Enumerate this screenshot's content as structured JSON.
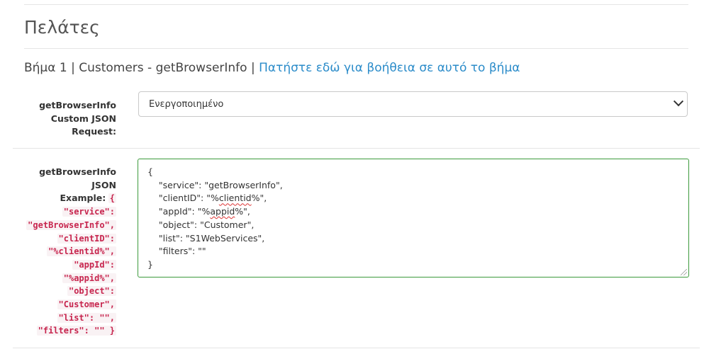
{
  "page": {
    "section_title": "Πελάτες",
    "step_prefix": "Βήμα 1 | Customers - getBrowserInfo |",
    "help_link": "Πατήστε εδώ για βοήθεια σε αυτό το βήμα"
  },
  "field_custom_request": {
    "label_lines": [
      "getBrowserInfo",
      "Custom JSON",
      "Request:"
    ],
    "selected_value": "Ενεργοποιημένο"
  },
  "field_json": {
    "label_lines": [
      "getBrowserInfo",
      "JSON"
    ],
    "example_word": "Example:",
    "example_code_lines": [
      "{",
      "\"service\":",
      "\"getBrowserInfo\",",
      "\"clientID\":",
      "\"%clientid%\",",
      "\"appId\":",
      "\"%appid%\",",
      "\"object\":",
      "\"Customer\",",
      "\"list\": \"\",",
      "\"filters\": \"\" }"
    ],
    "textarea_lines": [
      "{",
      "    \"service\": \"getBrowserInfo\",",
      "    \"clientID\": \"%",
      "clientid",
      "%\",",
      "    \"appId\": \"%",
      "appid",
      "%\",",
      "    \"object\": \"Customer\",",
      "    \"list\": \"S1WebServices\",",
      "    \"filters\": \"\"",
      "}"
    ]
  },
  "colors": {
    "link": "#2a8bc9",
    "code": "#c7254e",
    "textarea_border": "#3c9a3c"
  }
}
